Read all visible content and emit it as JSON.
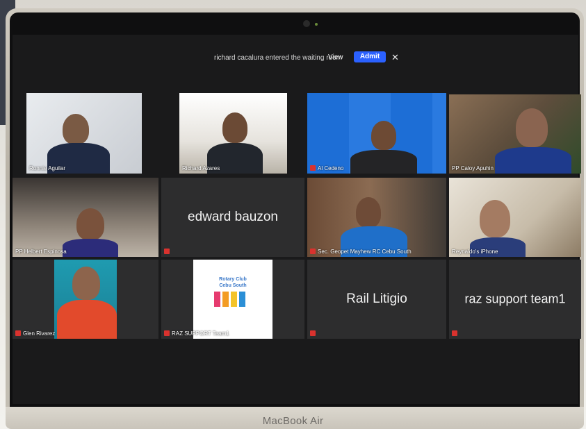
{
  "laptop": {
    "brand": "MacBook Air"
  },
  "waiting_notice": {
    "text": "richard cacalura entered the waiting room",
    "view_label": "View",
    "admit_label": "Admit",
    "close_glyph": "✕"
  },
  "participants": [
    {
      "name": "Ronnie Aguilar",
      "video": true
    },
    {
      "name": "Richard Azares",
      "video": true
    },
    {
      "name": "Al Cedeno",
      "video": true,
      "muted": true
    },
    {
      "name": "PP Caloy Apuhin",
      "video": true,
      "active_speaker": true
    },
    {
      "name": "PP Helbert Espinosa",
      "video": true
    },
    {
      "name": "edward bauzon",
      "video": false,
      "muted": true
    },
    {
      "name": "Sec. Geopet Mayhew RC Cebu South",
      "video": true,
      "muted": true
    },
    {
      "name": "Reynaldo's iPhone",
      "video": true
    },
    {
      "name": "Glen Rivarez",
      "video": true,
      "muted": true
    },
    {
      "name": "RAZ SUPPORT Team1",
      "video": true,
      "muted": true
    },
    {
      "name": "Rail Litigio",
      "video": false,
      "muted": true
    },
    {
      "name": "raz support team1",
      "video": false,
      "muted": true
    }
  ],
  "rotary_card": {
    "line1": "Rotary Club",
    "line2": "Cebu South"
  },
  "colors": {
    "admit_button": "#2b61ff",
    "active_border": "#d7e33a",
    "muted_icon": "#d9322e"
  },
  "icons": {
    "muted": "mic-muted-icon",
    "close": "close-icon"
  }
}
